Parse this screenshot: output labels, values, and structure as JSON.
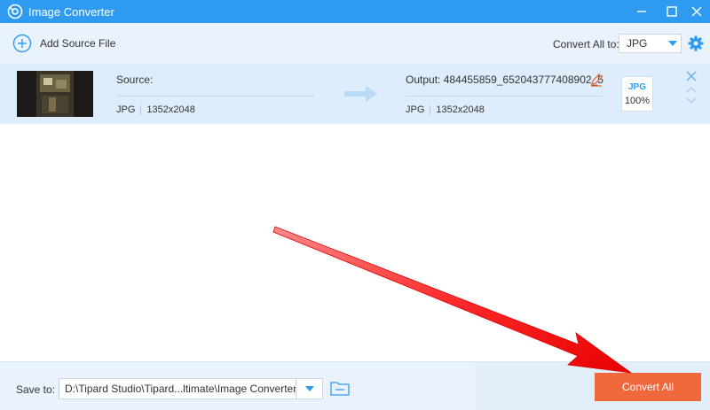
{
  "window": {
    "title": "Image Converter",
    "logo_icon": "app-logo-icon",
    "controls": [
      "minimize-icon",
      "maximize-icon",
      "close-icon"
    ]
  },
  "toolbar": {
    "add_source_label": "Add Source File",
    "add_source_icon": "plus-circle-icon",
    "convert_all_to_label": "Convert All to:",
    "format_value": "JPG",
    "settings_icon": "gear-icon"
  },
  "file": {
    "source_label": "Source:",
    "source_format": "JPG",
    "source_resolution": "1352x2048",
    "output_label": "Output: 484455859_652043777408902_5",
    "output_format": "JPG",
    "output_resolution": "1352x2048",
    "badge_format": "JPG",
    "badge_quality": "100%"
  },
  "bottom": {
    "save_to_label": "Save to:",
    "save_path": "D:\\Tipard Studio\\Tipard...ltimate\\Image Converter",
    "convert_all_label": "Convert All"
  },
  "colors": {
    "titlebar": "#2e9bf0",
    "accent": "#2e9bf0",
    "convert_button": "#f2683d",
    "annotation_arrow": "#ff1a1a"
  }
}
